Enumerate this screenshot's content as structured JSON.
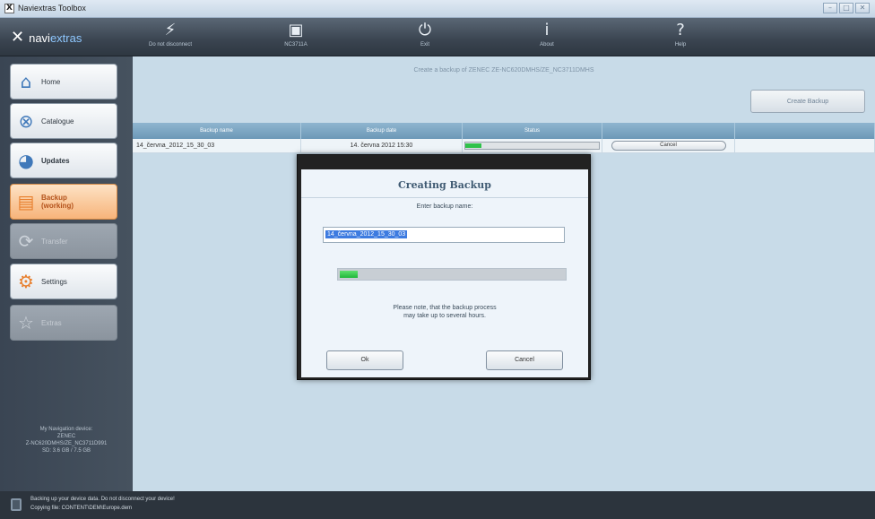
{
  "window": {
    "title": "Naviextras Toolbox",
    "app_icon": "X"
  },
  "toolbar": {
    "logo_mark": "✕",
    "logo_prefix": "navi",
    "logo_suffix": "extras",
    "items": [
      {
        "label": "Do not disconnect",
        "icon": "plug-icon",
        "glyph": "⚡"
      },
      {
        "label": "NC3711A",
        "icon": "device-icon",
        "glyph": "▣"
      },
      {
        "label": "Exit",
        "icon": "power-icon",
        "glyph": "⏻"
      },
      {
        "label": "About",
        "icon": "info-icon",
        "glyph": "i"
      },
      {
        "label": "Help",
        "icon": "help-icon",
        "glyph": "?"
      }
    ]
  },
  "sidebar": {
    "items": [
      {
        "label": "Home",
        "icon": "home-icon",
        "glyph": "⌂",
        "state": "normal"
      },
      {
        "label": "Catalogue",
        "icon": "catalogue-icon",
        "glyph": "⊗",
        "state": "normal"
      },
      {
        "label": "Updates",
        "icon": "updates-icon",
        "glyph": "◕",
        "state": "bold"
      },
      {
        "label": "Backup\n(working)",
        "icon": "backup-icon",
        "glyph": "▤",
        "state": "active"
      },
      {
        "label": "Transfer",
        "icon": "transfer-icon",
        "glyph": "⟳",
        "state": "disabled"
      },
      {
        "label": "Settings",
        "icon": "settings-icon",
        "glyph": "⚙",
        "state": "normal"
      },
      {
        "label": "Extras",
        "icon": "extras-icon",
        "glyph": "☆",
        "state": "disabled"
      }
    ],
    "device_info": "My Navigation device:\nZENEC\nZ-NC620DMHS/ZE_NC3711D991\nSD: 3.6 GB / 7.5 GB"
  },
  "main": {
    "title": "Create a backup of ZENEC ZE-NC620DMHS/ZE_NC3711DMHS",
    "create_backup_label": "Create Backup",
    "table": {
      "headers": [
        "Backup name",
        "Backup date",
        "Status",
        "",
        ""
      ],
      "rows": [
        {
          "name": "14_června_2012_15_30_03",
          "date": "14. června 2012 15:30",
          "progress": 0.12,
          "action": "Cancel"
        }
      ]
    }
  },
  "modal": {
    "title": "Creating Backup",
    "subtitle": "Enter backup name:",
    "input_value": "14_června_2012_15_30_03",
    "progress": 0.08,
    "note_line1": "Please note, that the backup process",
    "note_line2": "may take up to several hours.",
    "ok_label": "Ok",
    "cancel_label": "Cancel"
  },
  "statusbar": {
    "line1": "Backing up your device data. Do not disconnect your device!",
    "line2": "Copying file: CONTENT\\DEM\\Europe.dem"
  },
  "colors": {
    "accent": "#f7b47a",
    "progress": "#2fc24a",
    "header": "#6c98b7"
  }
}
